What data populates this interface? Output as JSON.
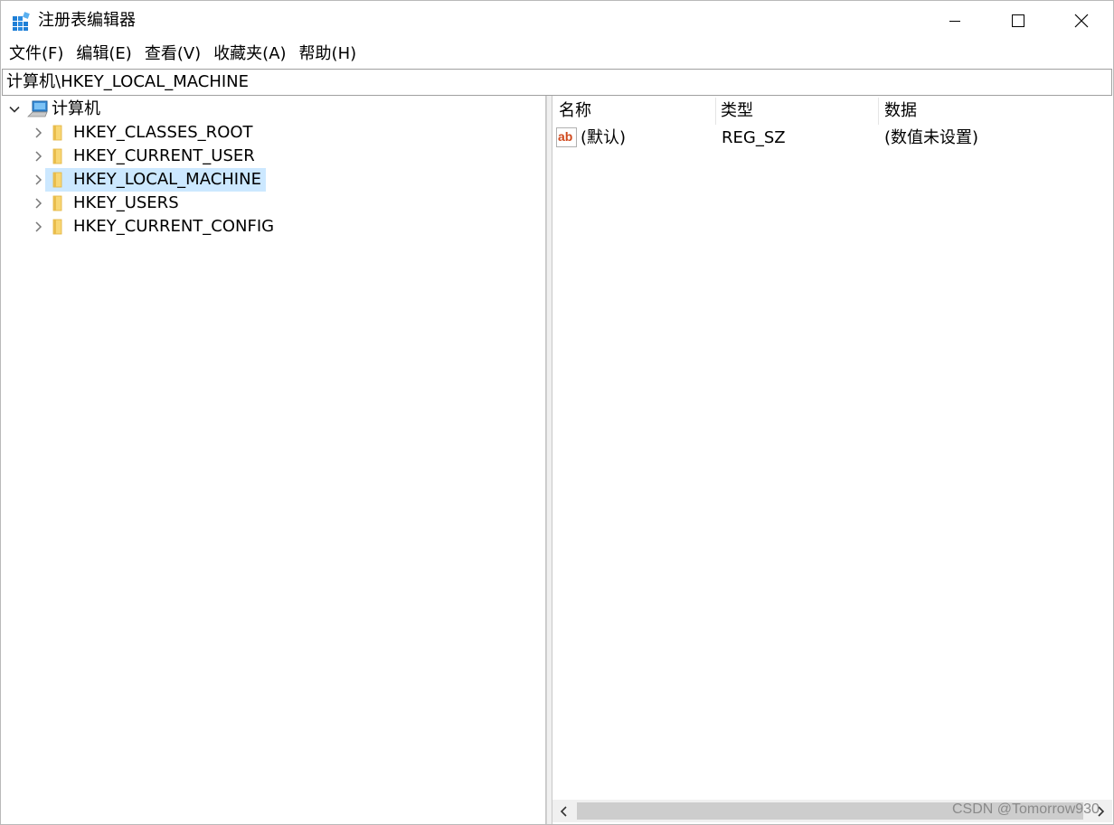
{
  "window": {
    "title": "注册表编辑器",
    "controls": {
      "minimize": "minimize-icon",
      "maximize": "maximize-icon",
      "close": "close-icon"
    }
  },
  "menu": [
    {
      "label": "文件(F)"
    },
    {
      "label": "编辑(E)"
    },
    {
      "label": "查看(V)"
    },
    {
      "label": "收藏夹(A)"
    },
    {
      "label": "帮助(H)"
    }
  ],
  "address": {
    "value": "计算机\\HKEY_LOCAL_MACHINE"
  },
  "tree": {
    "root": {
      "label": "计算机",
      "expanded": true,
      "icon": "computer-icon"
    },
    "children": [
      {
        "label": "HKEY_CLASSES_ROOT",
        "selected": false
      },
      {
        "label": "HKEY_CURRENT_USER",
        "selected": false
      },
      {
        "label": "HKEY_LOCAL_MACHINE",
        "selected": true
      },
      {
        "label": "HKEY_USERS",
        "selected": false
      },
      {
        "label": "HKEY_CURRENT_CONFIG",
        "selected": false
      }
    ]
  },
  "list": {
    "columns": [
      "名称",
      "类型",
      "数据"
    ],
    "rows": [
      {
        "name": "(默认)",
        "type": "REG_SZ",
        "data": "(数值未设置)",
        "icon": "string-value-icon"
      }
    ]
  },
  "watermark": "CSDN @Tomorrow930",
  "colors": {
    "selection": "#cce8ff",
    "folder": "#f8d775",
    "scroll_thumb": "#cdcdcd"
  }
}
